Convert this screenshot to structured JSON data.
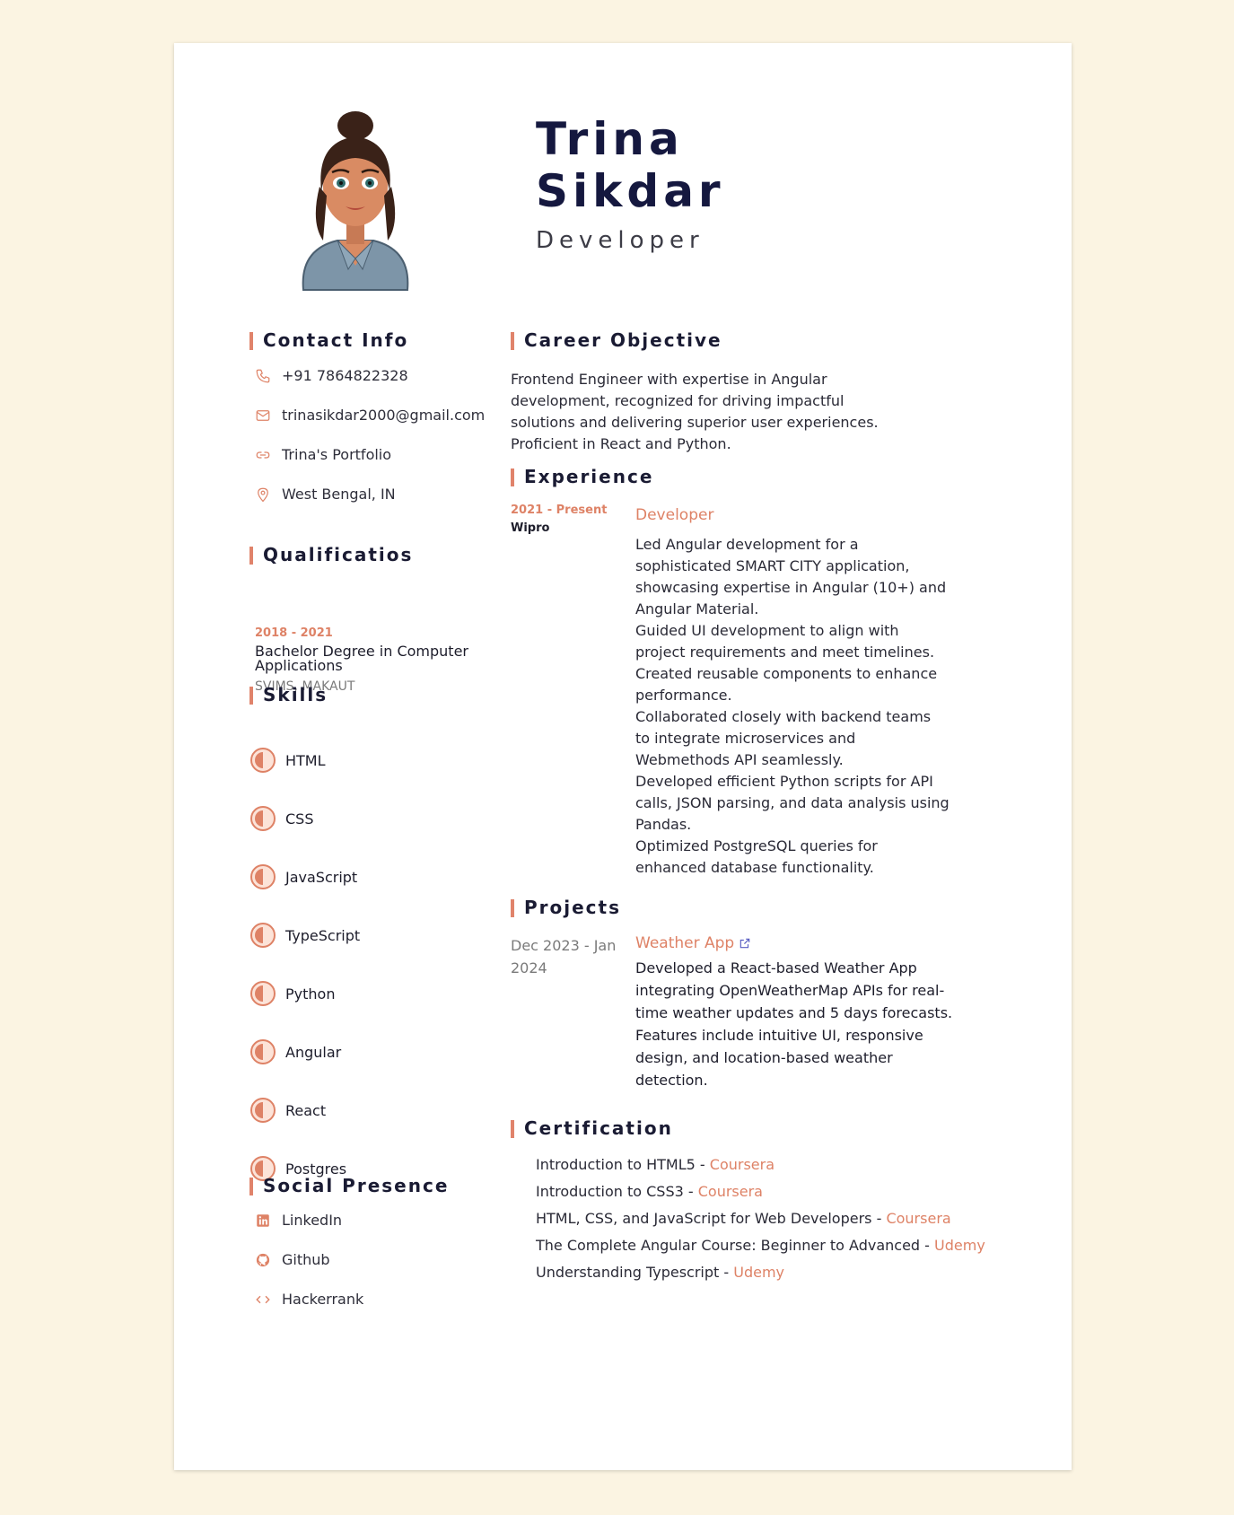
{
  "header": {
    "first_name": "Trina",
    "last_name": "Sikdar",
    "role": "Developer"
  },
  "contact": {
    "title": "Contact Info",
    "items": [
      {
        "icon": "phone-icon",
        "text": "+91 7864822328"
      },
      {
        "icon": "mail-icon",
        "text": "trinasikdar2000@gmail.com"
      },
      {
        "icon": "link-icon",
        "text": "Trina's Portfolio"
      },
      {
        "icon": "location-pin-icon",
        "text": "West Bengal, IN"
      }
    ]
  },
  "qualifications": {
    "title": "Qualificatios",
    "years": "2018 - 2021",
    "degree": "Bachelor Degree in Computer Applications",
    "institution": "SVIMS, MAKAUT"
  },
  "skills": {
    "title": "Skills",
    "items": [
      {
        "name": "HTML",
        "level": 0.5
      },
      {
        "name": "CSS",
        "level": 0.5
      },
      {
        "name": "JavaScript",
        "level": 0.5
      },
      {
        "name": "TypeScript",
        "level": 0.5
      },
      {
        "name": "Python",
        "level": 0.5
      },
      {
        "name": "Angular",
        "level": 0.5
      },
      {
        "name": "React",
        "level": 0.5
      },
      {
        "name": "Postgres",
        "level": 0.5
      }
    ]
  },
  "social": {
    "title": "Social Presence",
    "items": [
      {
        "icon": "linkedin-icon",
        "text": "LinkedIn"
      },
      {
        "icon": "github-icon",
        "text": "Github"
      },
      {
        "icon": "code-icon",
        "text": "Hackerrank"
      }
    ]
  },
  "objective": {
    "title": "Career Objective",
    "text": "Frontend Engineer with expertise in Angular development, recognized for driving impactful solutions and delivering superior user experiences. Proficient in React and Python."
  },
  "experience": {
    "title": "Experience",
    "date": "2021 - Present",
    "company": "Wipro",
    "role": "Developer",
    "bullets": [
      "Led Angular development for a sophisticated SMART CITY application, showcasing expertise in Angular (10+) and Angular Material.",
      "Guided UI development to align with project requirements and meet timelines.",
      "Created reusable components to enhance performance.",
      "Collaborated closely with backend teams to integrate microservices and Webmethods API seamlessly.",
      "Developed efficient Python scripts for API calls, JSON parsing, and data analysis using Pandas.",
      "Optimized PostgreSQL queries for enhanced database functionality."
    ]
  },
  "projects": {
    "title": "Projects",
    "date": "Dec 2023 - Jan 2024",
    "name": "Weather App",
    "description": "Developed a React-based Weather App integrating OpenWeatherMap APIs for real-time weather updates and 5 days forecasts. Features include intuitive UI, responsive design, and location-based weather detection."
  },
  "certification": {
    "title": "Certification",
    "items": [
      {
        "course": "Introduction to HTML5 - ",
        "provider": "Coursera"
      },
      {
        "course": "Introduction to CSS3 - ",
        "provider": "Coursera"
      },
      {
        "course": "HTML, CSS, and JavaScript for Web Developers - ",
        "provider": "Coursera"
      },
      {
        "course": "The Complete Angular Course: Beginner to Advanced - ",
        "provider": "Udemy"
      },
      {
        "course": "Understanding Typescript - ",
        "provider": "Udemy"
      }
    ]
  },
  "colors": {
    "accent": "#de8266",
    "navy": "#15183f",
    "background": "#fbf4e2"
  }
}
